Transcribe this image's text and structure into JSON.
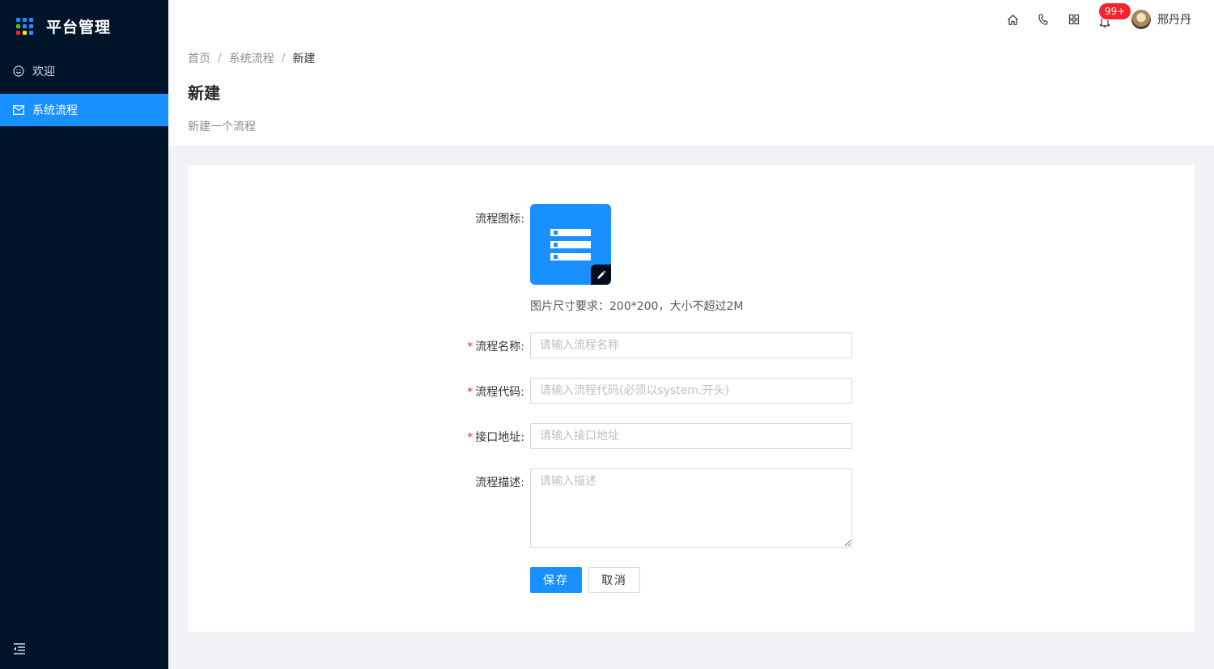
{
  "app": {
    "title": "平台管理"
  },
  "sidebar": {
    "items": [
      {
        "label": "欢迎",
        "icon": "smile-icon",
        "active": false
      },
      {
        "label": "系统流程",
        "icon": "mail-icon",
        "active": true
      }
    ],
    "collapse_icon": "menu-fold-icon"
  },
  "header": {
    "icons": [
      "home-icon",
      "phone-icon",
      "apps-icon",
      "bell-icon"
    ],
    "notification_badge": "99+",
    "user_name": "邢丹丹"
  },
  "breadcrumb": {
    "items": [
      "首页",
      "系统流程",
      "新建"
    ],
    "separator": "/"
  },
  "page": {
    "title": "新建",
    "description": "新建一个流程"
  },
  "form": {
    "icon_label": "流程图标:",
    "icon_hint": "图片尺寸要求：200*200，大小不超过2M",
    "name_label": "流程名称:",
    "name_placeholder": "请输入流程名称",
    "code_label": "流程代码:",
    "code_placeholder": "请输入流程代码(必须以system.开头)",
    "api_label": "接口地址:",
    "api_placeholder": "请输入接口地址",
    "desc_label": "流程描述:",
    "desc_placeholder": "请输入描述",
    "required_mark": "*",
    "save_label": "保存",
    "cancel_label": "取消"
  },
  "colors": {
    "sidebar_bg": "#001529",
    "primary": "#1890ff",
    "danger": "#f5222d",
    "logo_dots": [
      "#1890ff",
      "#1890ff",
      "#1890ff",
      "#52c41a",
      "#1890ff",
      "#1890ff",
      "#f5222d",
      "#fadb14",
      "#1890ff"
    ]
  }
}
